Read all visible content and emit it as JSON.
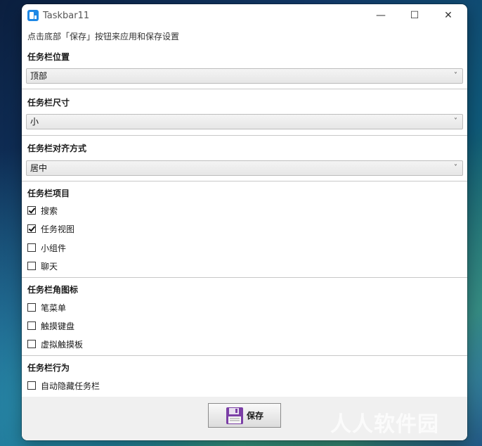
{
  "window": {
    "title": "Taskbar11",
    "minimize": "—",
    "maximize": "☐",
    "close": "✕"
  },
  "hint": "点击底部「保存」按钮来应用和保存设置",
  "position": {
    "label": "任务栏位置",
    "value": "顶部"
  },
  "size": {
    "label": "任务栏尺寸",
    "value": "小"
  },
  "alignment": {
    "label": "任务栏对齐方式",
    "value": "居中"
  },
  "chevron": "˅",
  "items": {
    "label": "任务栏项目",
    "options": [
      {
        "label": "搜索",
        "checked": true
      },
      {
        "label": "任务视图",
        "checked": true
      },
      {
        "label": "小组件",
        "checked": false
      },
      {
        "label": "聊天",
        "checked": false
      }
    ]
  },
  "corner_icons": {
    "label": "任务栏角图标",
    "options": [
      {
        "label": "笔菜单",
        "checked": false
      },
      {
        "label": "触摸键盘",
        "checked": false
      },
      {
        "label": "虚拟触摸板",
        "checked": false
      }
    ]
  },
  "behavior": {
    "label": "任务栏行为",
    "options": [
      {
        "label": "自动隐藏任务栏",
        "checked": false
      }
    ]
  },
  "footer": {
    "save_label": "保存"
  },
  "watermark": "人人软件园"
}
